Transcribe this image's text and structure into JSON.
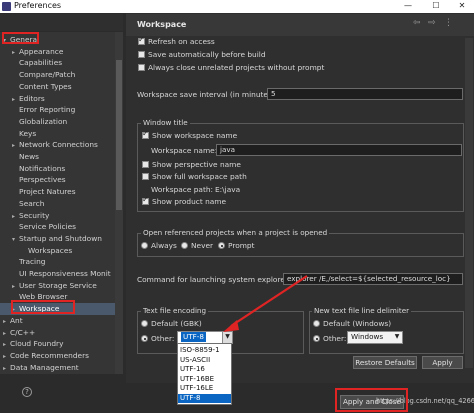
{
  "window": {
    "title": "Preferences",
    "controls": [
      "—",
      "☐",
      "✕"
    ]
  },
  "tree": {
    "items": [
      {
        "label": "General",
        "expanded": true,
        "indent": 0,
        "selected": false
      },
      {
        "label": "Appearance",
        "expanded": false,
        "indent": 1,
        "hasChildren": true
      },
      {
        "label": "Capabilities",
        "indent": 1
      },
      {
        "label": "Compare/Patch",
        "indent": 1
      },
      {
        "label": "Content Types",
        "indent": 1
      },
      {
        "label": "Editors",
        "expanded": false,
        "indent": 1,
        "hasChildren": true
      },
      {
        "label": "Error Reporting",
        "indent": 1
      },
      {
        "label": "Globalization",
        "indent": 1
      },
      {
        "label": "Keys",
        "indent": 1
      },
      {
        "label": "Network Connections",
        "expanded": false,
        "indent": 1,
        "hasChildren": true
      },
      {
        "label": "News",
        "indent": 1
      },
      {
        "label": "Notifications",
        "indent": 1
      },
      {
        "label": "Perspectives",
        "indent": 1
      },
      {
        "label": "Project Natures",
        "indent": 1
      },
      {
        "label": "Search",
        "indent": 1
      },
      {
        "label": "Security",
        "expanded": false,
        "indent": 1,
        "hasChildren": true
      },
      {
        "label": "Service Policies",
        "indent": 1
      },
      {
        "label": "Startup and Shutdown",
        "expanded": true,
        "indent": 1,
        "hasChildren": true
      },
      {
        "label": "Workspaces",
        "indent": 2
      },
      {
        "label": "Tracing",
        "indent": 1
      },
      {
        "label": "UI Responsiveness Monit",
        "indent": 1
      },
      {
        "label": "User Storage Service",
        "expanded": false,
        "indent": 1,
        "hasChildren": true
      },
      {
        "label": "Web Browser",
        "indent": 1
      },
      {
        "label": "Workspace",
        "expanded": false,
        "indent": 1,
        "hasChildren": true,
        "selected": true
      },
      {
        "label": "Ant",
        "expanded": false,
        "indent": 0,
        "hasChildren": true
      },
      {
        "label": "C/C++",
        "expanded": false,
        "indent": 0,
        "hasChildren": true
      },
      {
        "label": "Cloud Foundry",
        "expanded": false,
        "indent": 0,
        "hasChildren": true
      },
      {
        "label": "Code Recommenders",
        "expanded": false,
        "indent": 0,
        "hasChildren": true
      },
      {
        "label": "Data Management",
        "expanded": false,
        "indent": 0,
        "hasChildren": true
      }
    ]
  },
  "page": {
    "title": "Workspace",
    "options": {
      "refresh_on_access": {
        "label": "Refresh on access",
        "checked": true
      },
      "save_auto": {
        "label": "Save automatically before build",
        "checked": false
      },
      "close_unrelated": {
        "label": "Always close unrelated projects without prompt",
        "checked": false
      }
    },
    "save_interval": {
      "label": "Workspace save interval (in minutes):",
      "value": "5"
    },
    "window_title": {
      "group_label": "Window title",
      "show_workspace_name": {
        "label": "Show workspace name",
        "checked": true
      },
      "workspace_name_label": "Workspace name:",
      "workspace_name_value": "java",
      "show_perspective_name": {
        "label": "Show perspective name",
        "checked": false
      },
      "show_full_path": {
        "label": "Show full workspace path",
        "checked": false
      },
      "workspace_path_label": "Workspace path:",
      "workspace_path_value": "E:\\java",
      "show_product_name": {
        "label": "Show product name",
        "checked": true
      }
    },
    "open_referenced": {
      "group_label": "Open referenced projects when a project is opened",
      "options": [
        "Always",
        "Never",
        "Prompt"
      ],
      "selected": "Prompt"
    },
    "explorer_cmd": {
      "label": "Command for launching system explorer:",
      "value": "explorer /E,/select=${selected_resource_loc}"
    },
    "text_encoding": {
      "group_label": "Text file encoding",
      "default_label": "Default (GBK)",
      "other_label": "Other:",
      "selected_radio": "Other",
      "other_value": "UTF-8"
    },
    "line_delimiter": {
      "group_label": "New text file line delimiter",
      "default_label": "Default (Windows)",
      "other_label": "Other:",
      "selected_radio": "Other",
      "other_value": "Windows"
    },
    "restore_defaults": "Restore Defaults",
    "apply": "Apply",
    "apply_and_close": "Apply and Close",
    "watermark": "https://blog.csdn.net/qq_42660327"
  },
  "dropdown": {
    "options": [
      "ISO-8859-1",
      "US-ASCII",
      "UTF-16",
      "UTF-16BE",
      "UTF-16LE",
      "UTF-8"
    ],
    "highlighted": "UTF-8"
  },
  "colors": {
    "annotation": "#e02424",
    "selection": "#0a66c2"
  }
}
